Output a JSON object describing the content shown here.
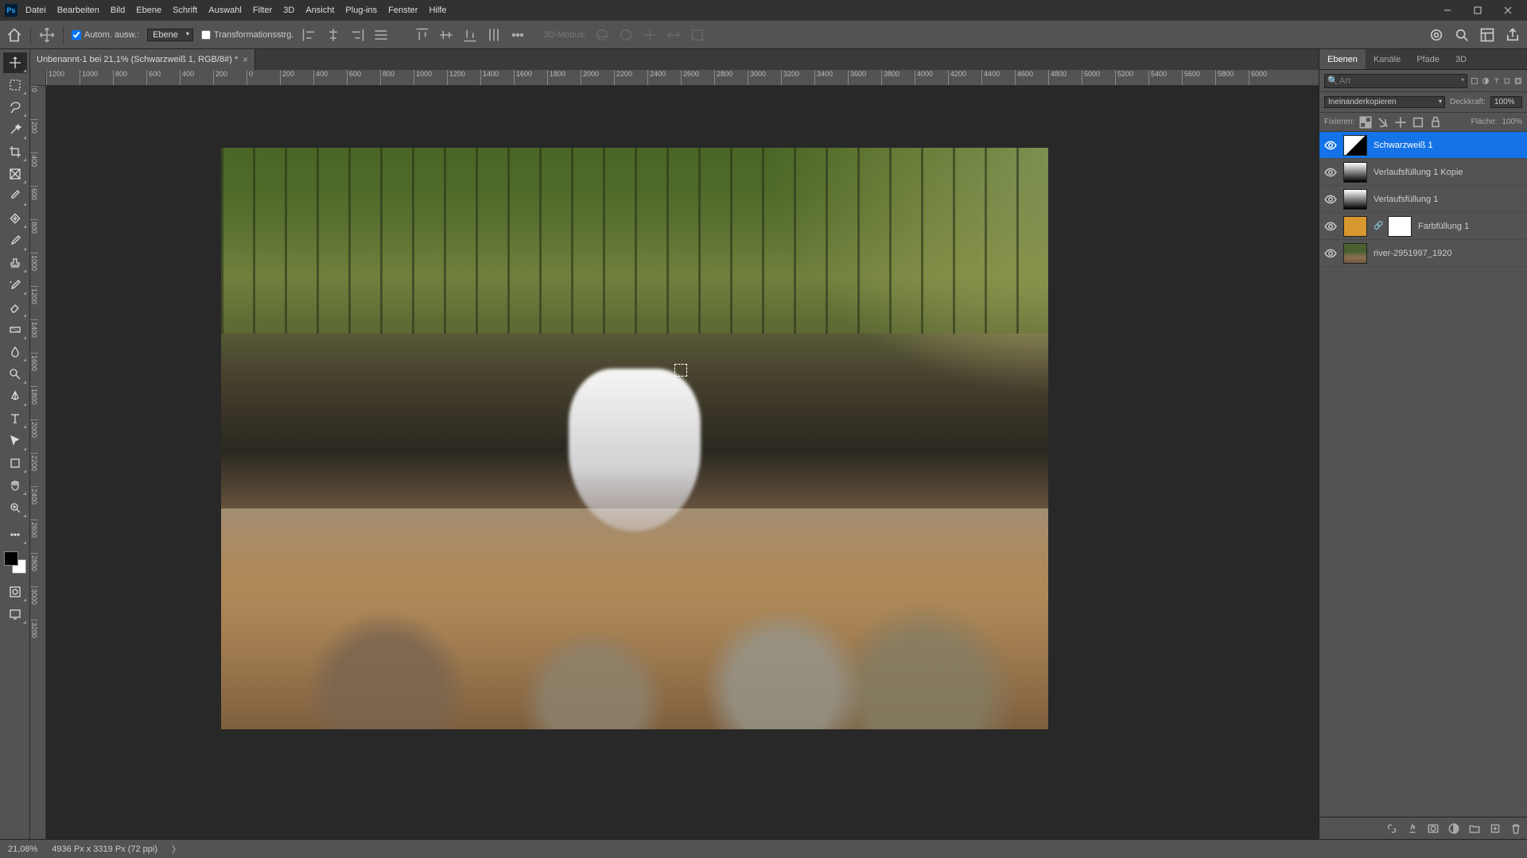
{
  "menu": {
    "items": [
      "Datei",
      "Bearbeiten",
      "Bild",
      "Ebene",
      "Schrift",
      "Auswahl",
      "Filter",
      "3D",
      "Ansicht",
      "Plug-ins",
      "Fenster",
      "Hilfe"
    ]
  },
  "window": {
    "app_icon": "Ps"
  },
  "optbar": {
    "auto_select": "Autom. ausw.:",
    "target": "Ebene",
    "transform": "Transformationsstrg.",
    "mode3d": "3D-Modus:"
  },
  "doc": {
    "tab": "Unbenannt-1 bei 21,1% (Schwarzweiß 1, RGB/8#) *"
  },
  "ruler_h": [
    "1200",
    "1000",
    "800",
    "600",
    "400",
    "200",
    "0",
    "200",
    "400",
    "600",
    "800",
    "1000",
    "1200",
    "1400",
    "1600",
    "1800",
    "2000",
    "2200",
    "2400",
    "2600",
    "2800",
    "3000",
    "3200",
    "3400",
    "3600",
    "3800",
    "4000",
    "4200",
    "4400",
    "4600",
    "4800",
    "5000",
    "5200",
    "5400",
    "5600",
    "5800",
    "6000"
  ],
  "ruler_v": [
    "0",
    "200",
    "400",
    "600",
    "800",
    "1000",
    "1200",
    "1400",
    "1600",
    "1800",
    "2000",
    "2200",
    "2400",
    "2600",
    "2800",
    "3000",
    "3200"
  ],
  "panel": {
    "tabs": [
      "Ebenen",
      "Kanäle",
      "Pfade",
      "3D"
    ],
    "search_placeholder": "Art",
    "blend": "Ineinanderkopieren",
    "opacity_label": "Deckkraft:",
    "opacity": "100%",
    "lock_label": "Fixieren:",
    "fill_label": "Fläche:",
    "fill": "100%",
    "layers": [
      {
        "name": "Schwarzweiß 1",
        "type": "adj",
        "sel": true
      },
      {
        "name": "Verlaufsfüllung 1 Kopie",
        "type": "grad"
      },
      {
        "name": "Verlaufsfüllung 1",
        "type": "grad"
      },
      {
        "name": "Farbfüllung 1",
        "type": "color",
        "mask": true
      },
      {
        "name": "river-2951997_1920",
        "type": "img"
      }
    ]
  },
  "status": {
    "zoom": "21,08%",
    "dims": "4936 Px x 3319 Px (72 ppi)",
    "arrow": "〉"
  }
}
